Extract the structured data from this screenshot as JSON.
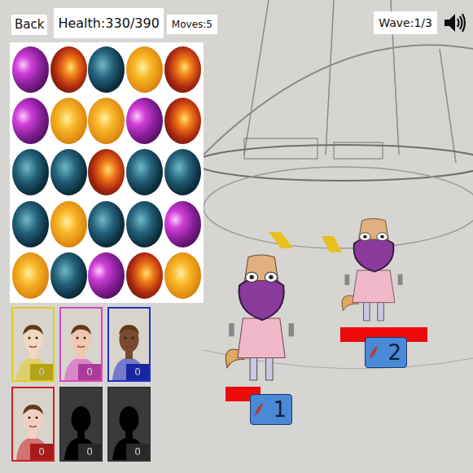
{
  "buttons": {
    "back": "Back"
  },
  "hud": {
    "health": "Health:330/390",
    "moves": "Moves:5",
    "wave": "Wave:1/3"
  },
  "board": {
    "rows": [
      [
        {
          "kind": "purple"
        },
        {
          "kind": "fire"
        },
        {
          "kind": "teal"
        },
        {
          "kind": "sun"
        },
        {
          "kind": "fire"
        }
      ],
      [
        {
          "kind": "purple"
        },
        {
          "kind": "sun"
        },
        {
          "kind": "sun"
        },
        {
          "kind": "purple"
        },
        {
          "kind": "fire"
        }
      ],
      [
        {
          "kind": "teal"
        },
        {
          "kind": "teal"
        },
        {
          "kind": "fire"
        },
        {
          "kind": "teal"
        },
        {
          "kind": "teal"
        }
      ],
      [
        {
          "kind": "teal"
        },
        {
          "kind": "sun"
        },
        {
          "kind": "teal"
        },
        {
          "kind": "teal"
        },
        {
          "kind": "purple"
        }
      ],
      [
        {
          "kind": "sun"
        },
        {
          "kind": "teal"
        },
        {
          "kind": "purple"
        },
        {
          "kind": "fire"
        },
        {
          "kind": "sun"
        }
      ]
    ]
  },
  "heroes": [
    {
      "kind": "portrait",
      "count": "0",
      "color": "#e0cc1a",
      "skin": "#f0d8c0"
    },
    {
      "kind": "portrait",
      "count": "0",
      "color": "#d848c0",
      "skin": "#f0c8b0"
    },
    {
      "kind": "portrait",
      "count": "0",
      "color": "#2030c8",
      "skin": "#7a4a30"
    },
    {
      "kind": "portrait",
      "count": "0",
      "color": "#d02020",
      "skin": "#f0d0c0"
    },
    {
      "kind": "locked",
      "count": "0",
      "color": "#333333",
      "skin": "#000000"
    },
    {
      "kind": "locked",
      "count": "0",
      "color": "#333333",
      "skin": "#000000"
    }
  ],
  "enemies": [
    {
      "label": "1",
      "level": 0.4
    },
    {
      "label": "2",
      "level": 1.0
    }
  ]
}
